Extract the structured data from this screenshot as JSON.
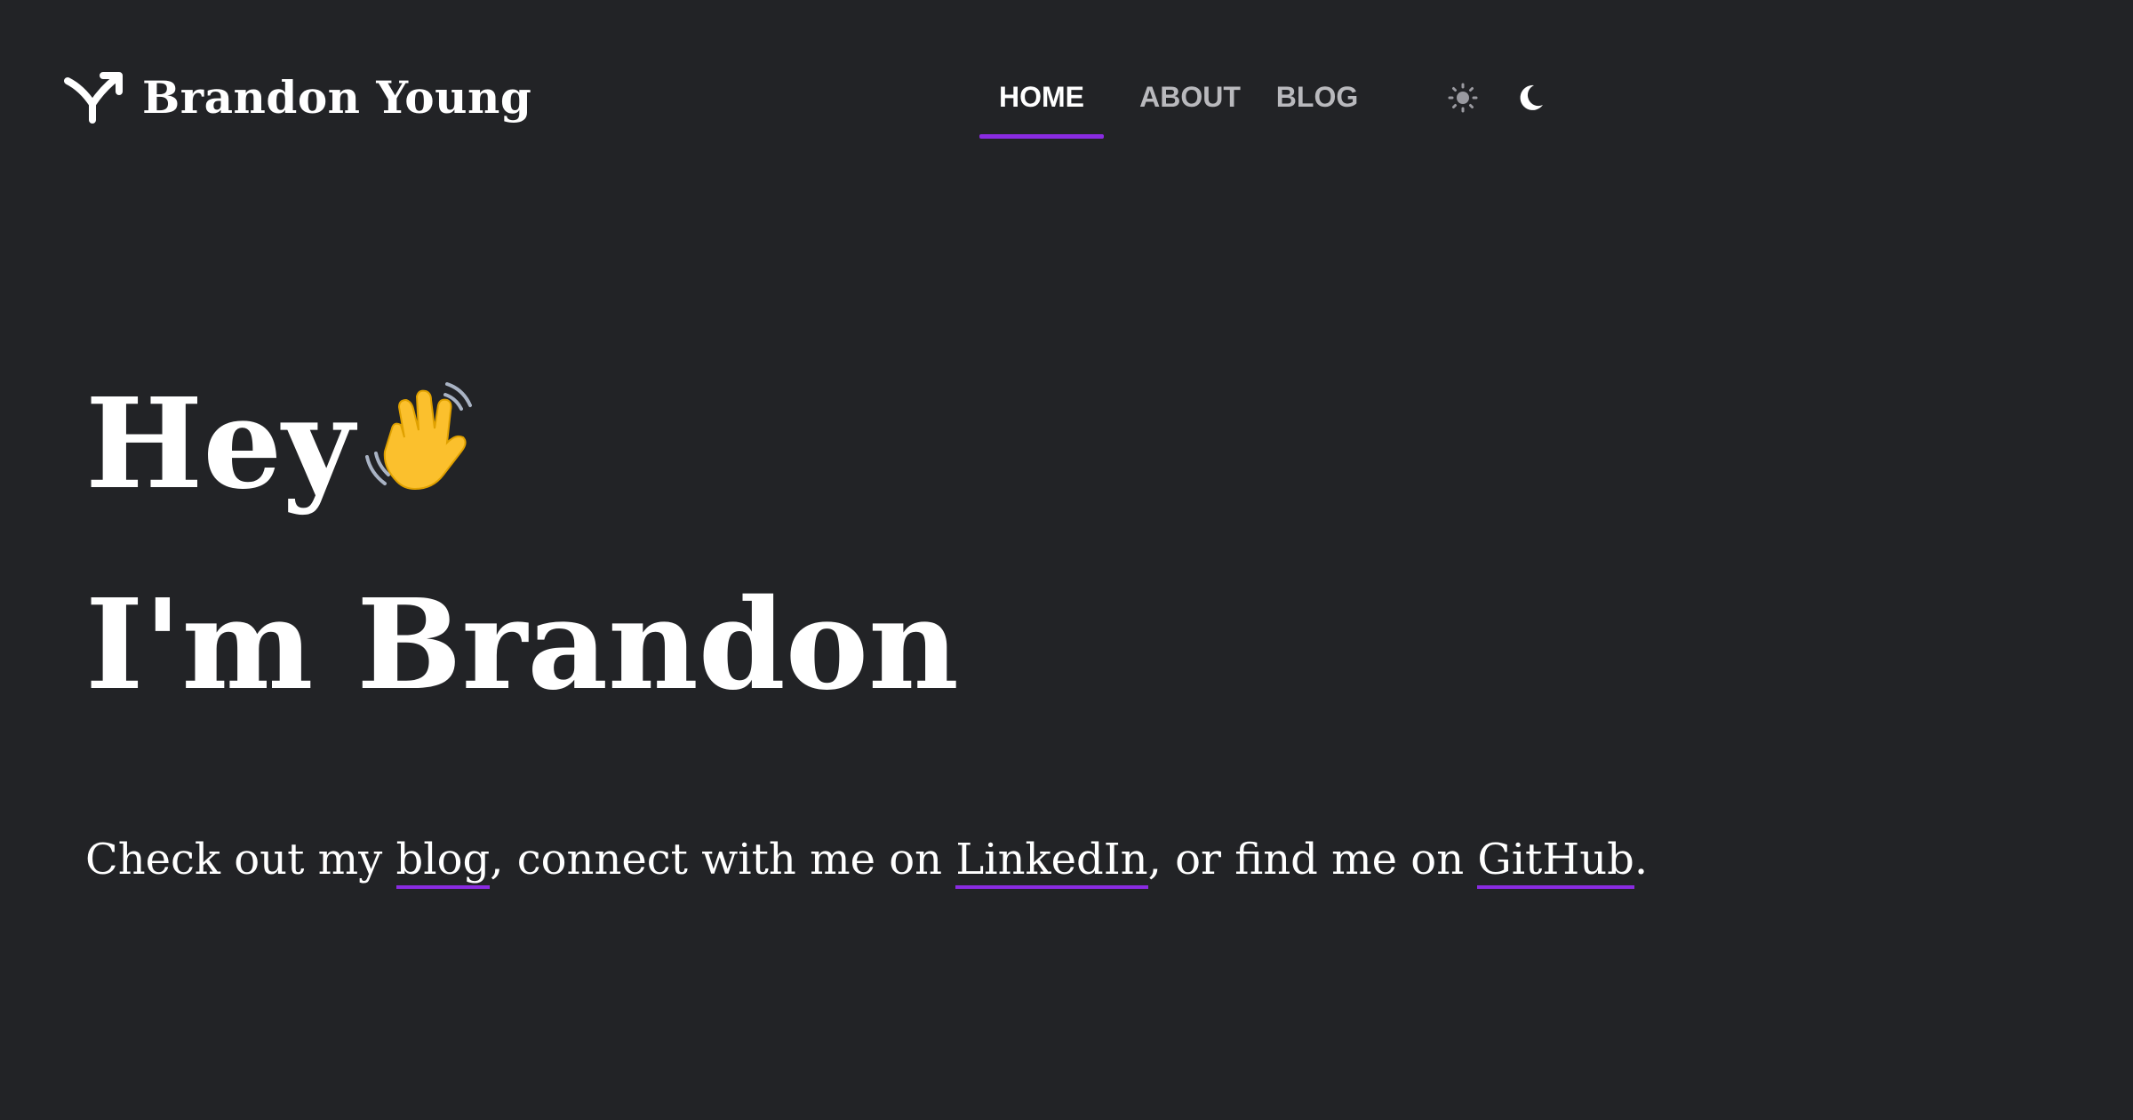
{
  "site": {
    "name": "Brandon Young",
    "logo_icon": "branch-arrow-icon"
  },
  "nav": {
    "items": [
      {
        "label": "HOME",
        "active": true
      },
      {
        "label": "ABOUT",
        "active": false
      },
      {
        "label": "BLOG",
        "active": false
      }
    ],
    "theme": {
      "light_icon": "sun-icon",
      "dark_icon": "moon-icon"
    }
  },
  "hero": {
    "greeting": "Hey",
    "greeting_emoji": "waving-hand-icon",
    "intro": "I'm Brandon"
  },
  "tagline": {
    "t1": "Check out my ",
    "link_blog": "blog",
    "t2": ", connect with me on ",
    "link_linkedin": "LinkedIn",
    "t3": ", or find me on ",
    "link_github": "GitHub",
    "t4": "."
  },
  "colors": {
    "background": "#222326",
    "accent": "#8a2be2",
    "text": "#ffffff",
    "nav_inactive": "#b9b9bd"
  }
}
